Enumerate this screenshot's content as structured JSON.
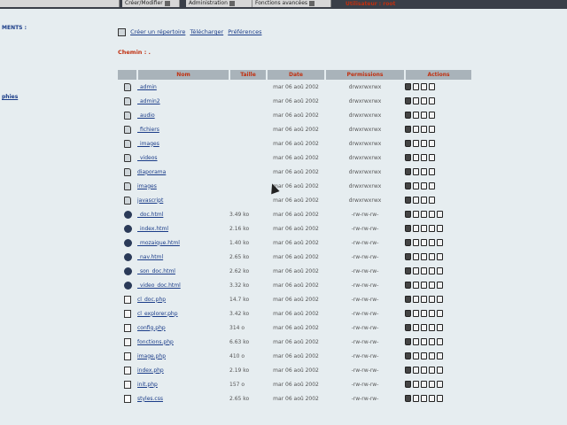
{
  "topbar": {
    "tabs": [
      "Créer/Modifier",
      "Administration",
      "Fonctions avancées"
    ],
    "user": "Utilisateur : root"
  },
  "left": {
    "label_top": "MENTS :",
    "label_mid": "phies"
  },
  "toolbar": {
    "create_dir": "Créer un répertoire",
    "upload": "Télécharger",
    "prefs": "Préférences"
  },
  "path": {
    "label": "Chemin : ."
  },
  "table": {
    "headers": {
      "name": "Nom",
      "size": "Taille",
      "date": "Date",
      "perms": "Permissions",
      "actions": "Actions"
    },
    "rows": [
      {
        "icon": "folder",
        "name": "_admin",
        "size": "",
        "date": "mar 06 aoû 2002",
        "perms": "drwxrwxrwx",
        "actions": 4
      },
      {
        "icon": "folder",
        "name": "_admin2",
        "size": "",
        "date": "mar 06 aoû 2002",
        "perms": "drwxrwxrwx",
        "actions": 4
      },
      {
        "icon": "folder",
        "name": "_audio",
        "size": "",
        "date": "mar 06 aoû 2002",
        "perms": "drwxrwxrwx",
        "actions": 4
      },
      {
        "icon": "folder",
        "name": "_fichiers",
        "size": "",
        "date": "mar 06 aoû 2002",
        "perms": "drwxrwxrwx",
        "actions": 4
      },
      {
        "icon": "folder",
        "name": "_images",
        "size": "",
        "date": "mar 06 aoû 2002",
        "perms": "drwxrwxrwx",
        "actions": 4
      },
      {
        "icon": "folder",
        "name": "_videos",
        "size": "",
        "date": "mar 06 aoû 2002",
        "perms": "drwxrwxrwx",
        "actions": 4
      },
      {
        "icon": "folder",
        "name": "diaporama",
        "size": "",
        "date": "mar 06 aoû 2002",
        "perms": "drwxrwxrwx",
        "actions": 4
      },
      {
        "icon": "folder",
        "name": "images",
        "size": "",
        "date": "mar 06 aoû 2002",
        "perms": "drwxrwxrwx",
        "actions": 4
      },
      {
        "icon": "folder",
        "name": "javascript",
        "size": "",
        "date": "mar 06 aoû 2002",
        "perms": "drwxrwxrwx",
        "actions": 4
      },
      {
        "icon": "html",
        "name": "_doc.html",
        "size": "3.49 ko",
        "date": "mar 06 aoû 2002",
        "perms": "-rw-rw-rw-",
        "actions": 5
      },
      {
        "icon": "html",
        "name": "_index.html",
        "size": "2.16 ko",
        "date": "mar 06 aoû 2002",
        "perms": "-rw-rw-rw-",
        "actions": 5
      },
      {
        "icon": "html",
        "name": "_mozaique.html",
        "size": "1.40 ko",
        "date": "mar 06 aoû 2002",
        "perms": "-rw-rw-rw-",
        "actions": 5
      },
      {
        "icon": "html",
        "name": "_nav.html",
        "size": "2.65 ko",
        "date": "mar 06 aoû 2002",
        "perms": "-rw-rw-rw-",
        "actions": 5
      },
      {
        "icon": "html",
        "name": "_son_doc.html",
        "size": "2.62 ko",
        "date": "mar 06 aoû 2002",
        "perms": "-rw-rw-rw-",
        "actions": 5
      },
      {
        "icon": "html",
        "name": "_video_doc.html",
        "size": "3.32 ko",
        "date": "mar 06 aoû 2002",
        "perms": "-rw-rw-rw-",
        "actions": 5
      },
      {
        "icon": "php",
        "name": "cl_doc.php",
        "size": "14.7 ko",
        "date": "mar 06 aoû 2002",
        "perms": "-rw-rw-rw-",
        "actions": 5
      },
      {
        "icon": "php",
        "name": "cl_explorer.php",
        "size": "3.42 ko",
        "date": "mar 06 aoû 2002",
        "perms": "-rw-rw-rw-",
        "actions": 5
      },
      {
        "icon": "php",
        "name": "config.php",
        "size": "314 o",
        "date": "mar 06 aoû 2002",
        "perms": "-rw-rw-rw-",
        "actions": 5
      },
      {
        "icon": "php",
        "name": "fonctions.php",
        "size": "6.63 ko",
        "date": "mar 06 aoû 2002",
        "perms": "-rw-rw-rw-",
        "actions": 5
      },
      {
        "icon": "php",
        "name": "image.php",
        "size": "410 o",
        "date": "mar 06 aoû 2002",
        "perms": "-rw-rw-rw-",
        "actions": 5
      },
      {
        "icon": "php",
        "name": "index.php",
        "size": "2.19 ko",
        "date": "mar 06 aoû 2002",
        "perms": "-rw-rw-rw-",
        "actions": 5
      },
      {
        "icon": "php",
        "name": "init.php",
        "size": "157 o",
        "date": "mar 06 aoû 2002",
        "perms": "-rw-rw-rw-",
        "actions": 5
      },
      {
        "icon": "css",
        "name": "styles.css",
        "size": "2.65 ko",
        "date": "mar 06 aoû 2002",
        "perms": "-rw-rw-rw-",
        "actions": 5
      }
    ]
  },
  "action_icons": [
    "trash-icon",
    "rename-icon",
    "copy-icon",
    "info-icon",
    "edit-icon"
  ]
}
